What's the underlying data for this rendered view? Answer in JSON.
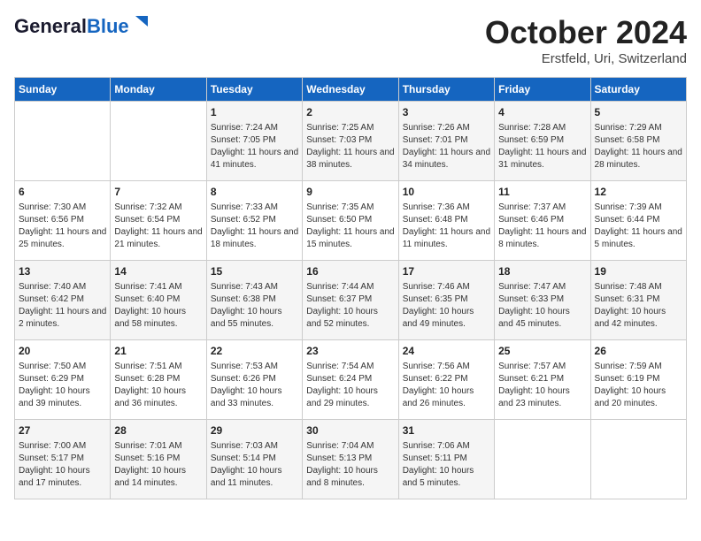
{
  "header": {
    "logo_general": "General",
    "logo_blue": "Blue",
    "month": "October 2024",
    "location": "Erstfeld, Uri, Switzerland"
  },
  "weekdays": [
    "Sunday",
    "Monday",
    "Tuesday",
    "Wednesday",
    "Thursday",
    "Friday",
    "Saturday"
  ],
  "weeks": [
    [
      {
        "day": "",
        "content": ""
      },
      {
        "day": "",
        "content": ""
      },
      {
        "day": "1",
        "content": "Sunrise: 7:24 AM\nSunset: 7:05 PM\nDaylight: 11 hours and 41 minutes."
      },
      {
        "day": "2",
        "content": "Sunrise: 7:25 AM\nSunset: 7:03 PM\nDaylight: 11 hours and 38 minutes."
      },
      {
        "day": "3",
        "content": "Sunrise: 7:26 AM\nSunset: 7:01 PM\nDaylight: 11 hours and 34 minutes."
      },
      {
        "day": "4",
        "content": "Sunrise: 7:28 AM\nSunset: 6:59 PM\nDaylight: 11 hours and 31 minutes."
      },
      {
        "day": "5",
        "content": "Sunrise: 7:29 AM\nSunset: 6:58 PM\nDaylight: 11 hours and 28 minutes."
      }
    ],
    [
      {
        "day": "6",
        "content": "Sunrise: 7:30 AM\nSunset: 6:56 PM\nDaylight: 11 hours and 25 minutes."
      },
      {
        "day": "7",
        "content": "Sunrise: 7:32 AM\nSunset: 6:54 PM\nDaylight: 11 hours and 21 minutes."
      },
      {
        "day": "8",
        "content": "Sunrise: 7:33 AM\nSunset: 6:52 PM\nDaylight: 11 hours and 18 minutes."
      },
      {
        "day": "9",
        "content": "Sunrise: 7:35 AM\nSunset: 6:50 PM\nDaylight: 11 hours and 15 minutes."
      },
      {
        "day": "10",
        "content": "Sunrise: 7:36 AM\nSunset: 6:48 PM\nDaylight: 11 hours and 11 minutes."
      },
      {
        "day": "11",
        "content": "Sunrise: 7:37 AM\nSunset: 6:46 PM\nDaylight: 11 hours and 8 minutes."
      },
      {
        "day": "12",
        "content": "Sunrise: 7:39 AM\nSunset: 6:44 PM\nDaylight: 11 hours and 5 minutes."
      }
    ],
    [
      {
        "day": "13",
        "content": "Sunrise: 7:40 AM\nSunset: 6:42 PM\nDaylight: 11 hours and 2 minutes."
      },
      {
        "day": "14",
        "content": "Sunrise: 7:41 AM\nSunset: 6:40 PM\nDaylight: 10 hours and 58 minutes."
      },
      {
        "day": "15",
        "content": "Sunrise: 7:43 AM\nSunset: 6:38 PM\nDaylight: 10 hours and 55 minutes."
      },
      {
        "day": "16",
        "content": "Sunrise: 7:44 AM\nSunset: 6:37 PM\nDaylight: 10 hours and 52 minutes."
      },
      {
        "day": "17",
        "content": "Sunrise: 7:46 AM\nSunset: 6:35 PM\nDaylight: 10 hours and 49 minutes."
      },
      {
        "day": "18",
        "content": "Sunrise: 7:47 AM\nSunset: 6:33 PM\nDaylight: 10 hours and 45 minutes."
      },
      {
        "day": "19",
        "content": "Sunrise: 7:48 AM\nSunset: 6:31 PM\nDaylight: 10 hours and 42 minutes."
      }
    ],
    [
      {
        "day": "20",
        "content": "Sunrise: 7:50 AM\nSunset: 6:29 PM\nDaylight: 10 hours and 39 minutes."
      },
      {
        "day": "21",
        "content": "Sunrise: 7:51 AM\nSunset: 6:28 PM\nDaylight: 10 hours and 36 minutes."
      },
      {
        "day": "22",
        "content": "Sunrise: 7:53 AM\nSunset: 6:26 PM\nDaylight: 10 hours and 33 minutes."
      },
      {
        "day": "23",
        "content": "Sunrise: 7:54 AM\nSunset: 6:24 PM\nDaylight: 10 hours and 29 minutes."
      },
      {
        "day": "24",
        "content": "Sunrise: 7:56 AM\nSunset: 6:22 PM\nDaylight: 10 hours and 26 minutes."
      },
      {
        "day": "25",
        "content": "Sunrise: 7:57 AM\nSunset: 6:21 PM\nDaylight: 10 hours and 23 minutes."
      },
      {
        "day": "26",
        "content": "Sunrise: 7:59 AM\nSunset: 6:19 PM\nDaylight: 10 hours and 20 minutes."
      }
    ],
    [
      {
        "day": "27",
        "content": "Sunrise: 7:00 AM\nSunset: 5:17 PM\nDaylight: 10 hours and 17 minutes."
      },
      {
        "day": "28",
        "content": "Sunrise: 7:01 AM\nSunset: 5:16 PM\nDaylight: 10 hours and 14 minutes."
      },
      {
        "day": "29",
        "content": "Sunrise: 7:03 AM\nSunset: 5:14 PM\nDaylight: 10 hours and 11 minutes."
      },
      {
        "day": "30",
        "content": "Sunrise: 7:04 AM\nSunset: 5:13 PM\nDaylight: 10 hours and 8 minutes."
      },
      {
        "day": "31",
        "content": "Sunrise: 7:06 AM\nSunset: 5:11 PM\nDaylight: 10 hours and 5 minutes."
      },
      {
        "day": "",
        "content": ""
      },
      {
        "day": "",
        "content": ""
      }
    ]
  ]
}
